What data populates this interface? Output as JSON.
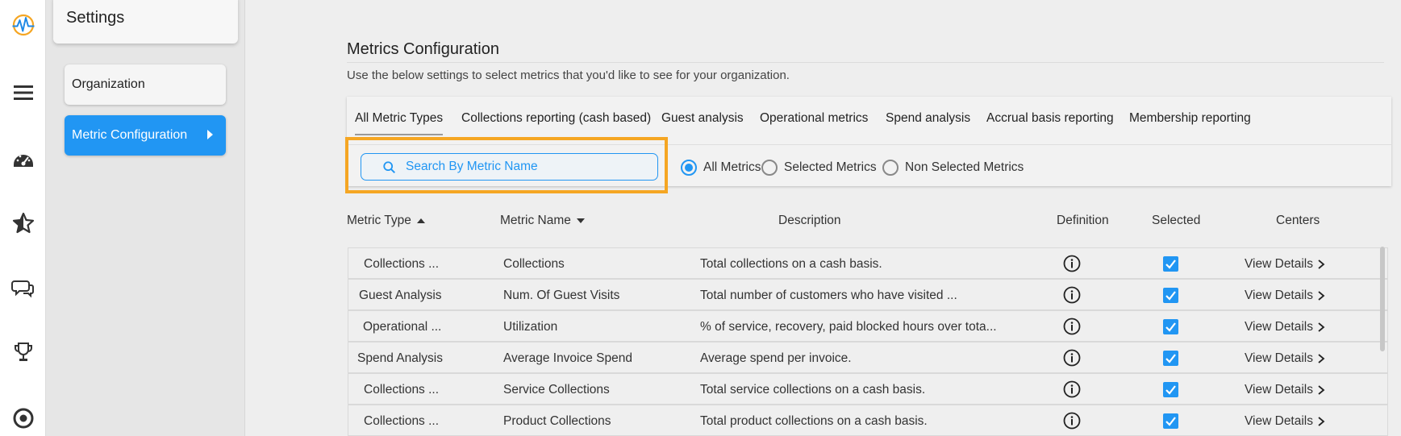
{
  "sidebar": {
    "title": "Settings",
    "items": [
      {
        "label": "Organization"
      },
      {
        "label": "Metric Configuration"
      }
    ]
  },
  "main": {
    "title": "Metrics Configuration",
    "subtitle": "Use the below settings to select metrics that you'd like to see for your organization.",
    "tabs": [
      "All Metric Types",
      "Collections reporting (cash based)",
      "Guest analysis",
      "Operational metrics",
      "Spend analysis",
      "Accrual basis reporting",
      "Membership reporting"
    ],
    "search": {
      "placeholder": "Search By Metric Name",
      "value": ""
    },
    "filters": [
      "All Metrics",
      "Selected Metrics",
      "Non Selected Metrics"
    ],
    "selected_filter": "All Metrics",
    "columns": [
      "Metric Type",
      "Metric Name",
      "Description",
      "Definition",
      "Selected",
      "Centers"
    ],
    "rows": [
      {
        "type": "Collections ...",
        "name": "Collections",
        "description": "Total collections on a cash basis.",
        "centers": "View Details"
      },
      {
        "type": "Guest Analysis",
        "name": "Num. Of Guest Visits",
        "description": "Total number of customers who have visited ...",
        "centers": "View Details"
      },
      {
        "type": "Operational ...",
        "name": "Utilization",
        "description": "% of service, recovery, paid blocked hours over tota...",
        "centers": "View Details"
      },
      {
        "type": "Spend Analysis",
        "name": "Average Invoice Spend",
        "description": "Average spend per invoice.",
        "centers": "View Details"
      },
      {
        "type": "Collections ...",
        "name": "Service Collections",
        "description": "Total service collections on a cash basis.",
        "centers": "View Details"
      },
      {
        "type": "Collections ...",
        "name": "Product Collections",
        "description": "Total product collections on a cash basis.",
        "centers": "View Details"
      }
    ]
  },
  "icons": {
    "rail": [
      "logo-icon",
      "menu-icon",
      "dashboard-icon",
      "star-icon",
      "chat-icon",
      "trophy-icon",
      "target-icon"
    ]
  },
  "colors": {
    "accent": "#2196f3",
    "highlight": "#f5a623"
  }
}
